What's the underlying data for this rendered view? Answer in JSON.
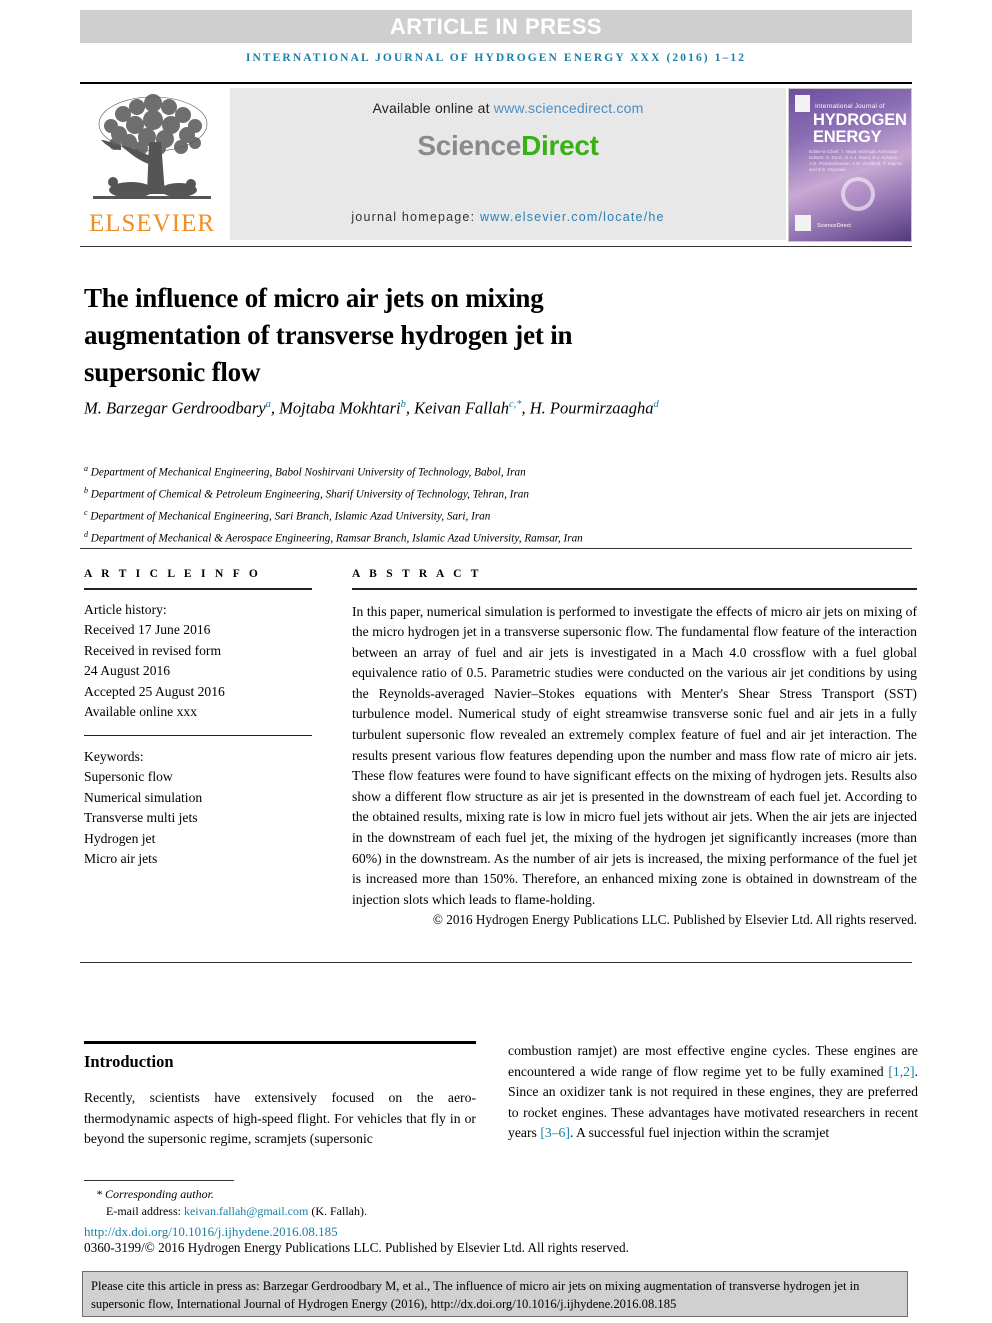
{
  "banner": {
    "article_in_press": "ARTICLE IN PRESS"
  },
  "running_head": "INTERNATIONAL JOURNAL OF HYDROGEN ENERGY XXX (2016) 1–12",
  "masthead": {
    "publisher_name": "ELSEVIER",
    "available_prefix": "Available online at ",
    "sciencedirect_url": "www.sciencedirect.com",
    "brand_part1": "Science",
    "brand_part2": "Direct",
    "homepage_label": "journal homepage: ",
    "homepage_url": "www.elsevier.com/locate/he",
    "cover": {
      "line_small": "International Journal of",
      "line1": "HYDROGEN",
      "line2": "ENERGY",
      "editors": "Editor-in-Chief: T. Nejat Veziroglu   Associate Editors: S. Dunn, D.A.J. Rand, R.J. Kovacs, A.E. Pourkashanian, J.W. Sheffield, Y. Kojima and E.E. Miyazaki",
      "sciencedirect_mark": "ScienceDirect"
    }
  },
  "title": "The influence of micro air jets on mixing augmentation of transverse hydrogen jet in supersonic flow",
  "authors": {
    "list": [
      {
        "name": "M. Barzegar Gerdroodbary",
        "marks": "a"
      },
      {
        "name": "Mojtaba Mokhtari",
        "marks": "b"
      },
      {
        "name": "Keivan Fallah",
        "marks": "c,*"
      },
      {
        "name": "H. Pourmirzaagha",
        "marks": "d"
      }
    ]
  },
  "affiliations": [
    {
      "mark": "a",
      "text": "Department of Mechanical Engineering, Babol Noshirvani University of Technology, Babol, Iran"
    },
    {
      "mark": "b",
      "text": "Department of Chemical & Petroleum Engineering, Sharif University of Technology, Tehran, Iran"
    },
    {
      "mark": "c",
      "text": "Department of Mechanical Engineering, Sari Branch, Islamic Azad University, Sari, Iran"
    },
    {
      "mark": "d",
      "text": "Department of Mechanical & Aerospace Engineering, Ramsar Branch, Islamic Azad University, Ramsar, Iran"
    }
  ],
  "article_info": {
    "heading": "A R T I C L E   I N F O",
    "history_label": "Article history:",
    "history": [
      "Received 17 June 2016",
      "Received in revised form",
      "24 August 2016",
      "Accepted 25 August 2016",
      "Available online xxx"
    ],
    "keywords_label": "Keywords:",
    "keywords": [
      "Supersonic flow",
      "Numerical simulation",
      "Transverse multi jets",
      "Hydrogen jet",
      "Micro air jets"
    ]
  },
  "abstract": {
    "heading": "A B S T R A C T",
    "body": "In this paper, numerical simulation is performed to investigate the effects of micro air jets on mixing of the micro hydrogen jet in a transverse supersonic flow. The fundamental flow feature of the interaction between an array of fuel and air jets is investigated in a Mach 4.0 crossflow with a fuel global equivalence ratio of 0.5. Parametric studies were conducted on the various air jet conditions by using the Reynolds-averaged Navier–Stokes equations with Menter's Shear Stress Transport (SST) turbulence model. Numerical study of eight streamwise transverse sonic fuel and air jets in a fully turbulent supersonic flow revealed an extremely complex feature of fuel and air jet interaction. The results present various flow features depending upon the number and mass flow rate of micro air jets. These flow features were found to have significant effects on the mixing of hydrogen jets. Results also show a different flow structure as air jet is presented in the downstream of each fuel jet. According to the obtained results, mixing rate is low in micro fuel jets without air jets. When the air jets are injected in the downstream of each fuel jet, the mixing of the hydrogen jet significantly increases (more than 60%) in the downstream. As the number of air jets is increased, the mixing performance of the fuel jet is increased more than 150%. Therefore, an enhanced mixing zone is obtained in downstream of the injection slots which leads to flame-holding.",
    "copyright": "© 2016 Hydrogen Energy Publications LLC. Published by Elsevier Ltd. All rights reserved."
  },
  "introduction": {
    "heading": "Introduction",
    "col_left": "Recently, scientists have extensively focused on the aero-thermodynamic aspects of high-speed flight. For vehicles that fly in or beyond the supersonic regime, scramjets (supersonic",
    "col_right_part1": "combustion ramjet) are most effective engine cycles. These engines are encountered a wide range of flow regime yet to be fully examined ",
    "ref1": "[1,2]",
    "col_right_part2": ". Since an oxidizer tank is not required in these engines, they are preferred to rocket engines. These advantages have motivated researchers in recent years ",
    "ref2": "[3–6]",
    "col_right_part3": ". A successful fuel injection within the scramjet"
  },
  "footnote": {
    "corresponding": "* Corresponding author.",
    "email_label": "E-mail address: ",
    "email": "keivan.fallah@gmail.com",
    "email_suffix": " (K. Fallah).",
    "doi": "http://dx.doi.org/10.1016/j.ijhydene.2016.08.185",
    "issn": "0360-3199/© 2016 Hydrogen Energy Publications LLC. Published by Elsevier Ltd. All rights reserved."
  },
  "cite_box": {
    "text": "Please cite this article in press as: Barzegar Gerdroodbary M, et al., The influence of micro air jets on mixing augmentation of transverse hydrogen jet in supersonic flow, International Journal of Hydrogen Energy (2016), http://dx.doi.org/10.1016/j.ijhydene.2016.08.185"
  },
  "colors": {
    "accent_blue": "#1a7fa8",
    "elsevier_orange": "#f08d23",
    "sciencedirect_green": "#3ab017",
    "banner_gray": "#cfcfcf"
  }
}
